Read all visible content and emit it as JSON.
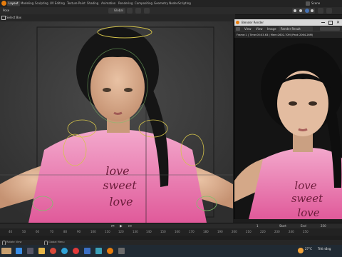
{
  "menubar": {
    "workspaces": [
      "Layout",
      "Modeling",
      "Sculpting",
      "UV Editing",
      "Texture Paint",
      "Shading",
      "Animation",
      "Rendering",
      "Compositing",
      "Geometry Nodes",
      "Scripting"
    ],
    "scene_label": "Scene"
  },
  "header": {
    "mode_label": "Pose",
    "transform_label": "Global",
    "select_box_label": "Select Box"
  },
  "render_window": {
    "title": "Blender Render",
    "menu": [
      "View",
      "View",
      "Image"
    ],
    "slot_label": "Render Result",
    "info": "Frame:1 | Time:00:03.63 | Mem:2602.70M (Peak 2064.26M)"
  },
  "timeline": {
    "ticks": [
      "40",
      "50",
      "60",
      "70",
      "80",
      "90",
      "100",
      "110",
      "120",
      "130",
      "140",
      "150",
      "160",
      "170",
      "180",
      "190",
      "200",
      "210",
      "220",
      "230",
      "240",
      "250"
    ],
    "start_label": "Start",
    "end_label": "End",
    "start_value": "1",
    "end_value": "250"
  },
  "statusbar": {
    "left": "Rotate View",
    "middle": "Global Menu"
  },
  "taskbar": {
    "temperature": "27°C",
    "weather": "Trời nắng"
  },
  "colors": {
    "accent": "#4772b3",
    "shirt_pink": "#e86aa8",
    "rig_yellow": "#d4c34a",
    "rig_green": "#7ec06a"
  }
}
